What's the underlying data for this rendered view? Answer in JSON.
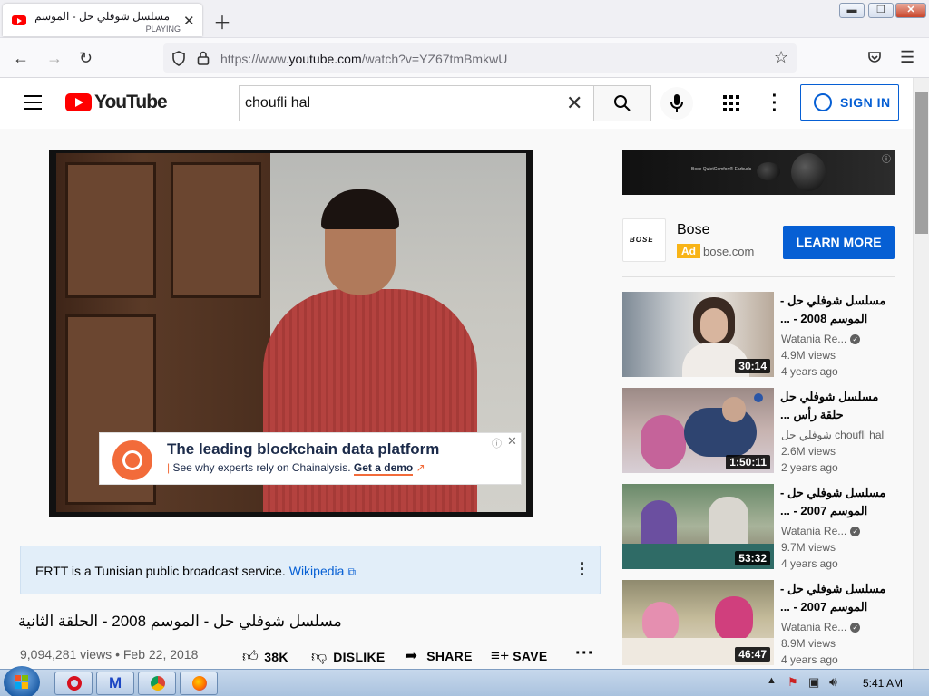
{
  "browser": {
    "tab": {
      "title": "مسلسل شوفلي حل - الموسم 2008 -",
      "subtitle": "PLAYING"
    },
    "url_prefix": "https://www.",
    "url_domain": "youtube.com",
    "url_path": "/watch?v=YZ67tmBmkwU"
  },
  "youtube": {
    "logo_text": "YouTube",
    "search_value": "choufli hal",
    "signin_label": "SIGN IN"
  },
  "video": {
    "overlay_ad": {
      "headline": "The leading blockchain data platform",
      "tagline": "See why experts rely on Chainalysis.",
      "cta": "Get a demo"
    },
    "info_panel": {
      "text": "ERTT is a Tunisian public broadcast service.",
      "link": "Wikipedia"
    },
    "title": "مسلسل شوفلي حل - الموسم 2008 - الحلقة الثانية",
    "meta": "9,094,281 views • Feb 22, 2018",
    "actions": {
      "likes": "38K",
      "dislike": "DISLIKE",
      "share": "SHARE",
      "save": "SAVE"
    }
  },
  "sidebar": {
    "ad": {
      "image_text": "Bose QuietComfort® Earbuds",
      "logo_text": "BOSE",
      "advertiser": "Bose",
      "tag": "Ad",
      "domain": "bose.com",
      "cta": "LEARN MORE"
    },
    "recommendations": [
      {
        "title": "مسلسل شوفلي حل - الموسم 2008 - ...",
        "channel": "Watania Re...",
        "verified": true,
        "views": "4.9M views",
        "age": "4 years ago",
        "duration": "30:14"
      },
      {
        "title": "مسلسل شوفلي حل حلقة رأس ...",
        "channel": "شوفلي حل choufli hal",
        "verified": false,
        "views": "2.6M views",
        "age": "2 years ago",
        "duration": "1:50:11"
      },
      {
        "title": "مسلسل شوفلي حل - الموسم 2007 - ...",
        "channel": "Watania Re...",
        "verified": true,
        "views": "9.7M views",
        "age": "4 years ago",
        "duration": "53:32"
      },
      {
        "title": "مسلسل شوفلي حل - الموسم 2007 - ...",
        "channel": "Watania Re...",
        "verified": true,
        "views": "8.9M views",
        "age": "4 years ago",
        "duration": "46:47"
      }
    ]
  },
  "taskbar": {
    "time": "5:41 AM"
  },
  "colors": {
    "accent": "#065fd4",
    "youtube_red": "#ff0000",
    "ad_yellow": "#f8b417",
    "info_bg": "#e2eef9"
  }
}
